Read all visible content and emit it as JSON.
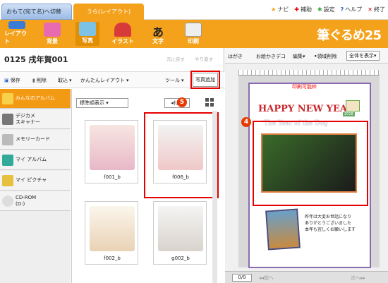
{
  "top": {
    "tab_omote": "おもて(宛て名)へ切替",
    "tab_ura": "うら(レイアウト)",
    "links": [
      "ナビ",
      "補助",
      "設定",
      "ヘルプ",
      "終了"
    ]
  },
  "toolbar": {
    "items": [
      "レイアウト",
      "背景",
      "写真",
      "イラスト",
      "文字",
      "印刷"
    ],
    "brand": "筆ぐるめ25"
  },
  "left": {
    "title": "0125 戌年賀001",
    "undo": "元に戻す",
    "redo": "やり直す",
    "sub": [
      "保存",
      "削除",
      "取込",
      "かんたんレイアウト",
      "ツール",
      "写真追加"
    ],
    "albums": [
      "みんなのアルバム",
      "デジカメ\nスキャナー",
      "メモリーカード",
      "マイ アルバム",
      "マイ ピクチャ",
      "CD-ROM\n(D:)"
    ],
    "sort": "標準順表示",
    "tag": "付箋",
    "photos": [
      "f001_b",
      "f006_b",
      "f002_b",
      "g002_b"
    ]
  },
  "right": {
    "tools": [
      "はがき",
      "お絵かきデコ",
      "編集",
      "領域削除",
      "全体を表示"
    ],
    "print_area": "印刷可能枠",
    "greeting": "HAPPY NEW YEAR",
    "year_dog": "The Year of the Dog",
    "badge_year": "2018",
    "message": "昨年は大変お世話になり\nありがとうございました\n本年も宜しくお願いします",
    "page": "0/0",
    "prev": "前へ",
    "next": "次へ"
  },
  "callouts": {
    "four": "4",
    "five": "5"
  },
  "colors": {
    "accent": "#f4a21b",
    "highlight": "#e60000",
    "callout": "#e63a00"
  }
}
